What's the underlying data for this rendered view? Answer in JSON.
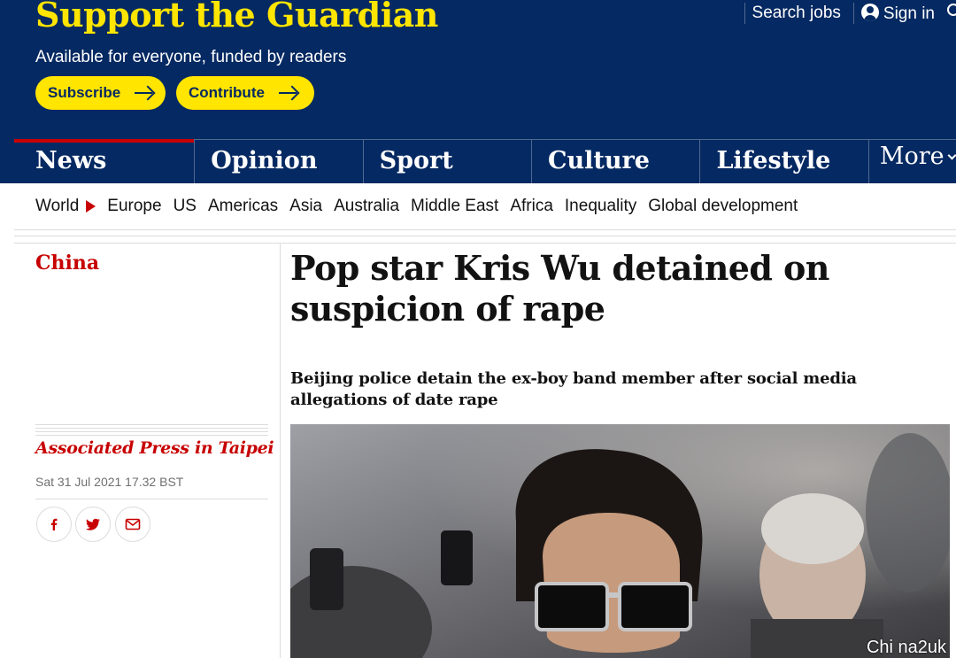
{
  "header": {
    "support_title": "Support the Guardian",
    "support_subtitle": "Available for everyone, funded by readers",
    "subscribe_label": "Subscribe",
    "contribute_label": "Contribute",
    "search_jobs_label": "Search jobs",
    "sign_in_label": "Sign in"
  },
  "pillars": [
    {
      "label": "News"
    },
    {
      "label": "Opinion"
    },
    {
      "label": "Sport"
    },
    {
      "label": "Culture"
    },
    {
      "label": "Lifestyle"
    },
    {
      "label": "More"
    }
  ],
  "subnav": [
    "World",
    "Europe",
    "US",
    "Americas",
    "Asia",
    "Australia",
    "Middle East",
    "Africa",
    "Inequality",
    "Global development"
  ],
  "article": {
    "section": "China",
    "headline": "Pop star Kris Wu detained on suspicion of rape",
    "standfirst": "Beijing police detain the ex-boy band member after social media allegations of date rape",
    "byline": "Associated Press in Taipei",
    "dateline": "Sat 31 Jul 2021 17.32 BST",
    "watermark": "Chi na2uk"
  },
  "colors": {
    "brand_blue": "#052962",
    "brand_yellow": "#ffe500",
    "news_red": "#c70000"
  }
}
